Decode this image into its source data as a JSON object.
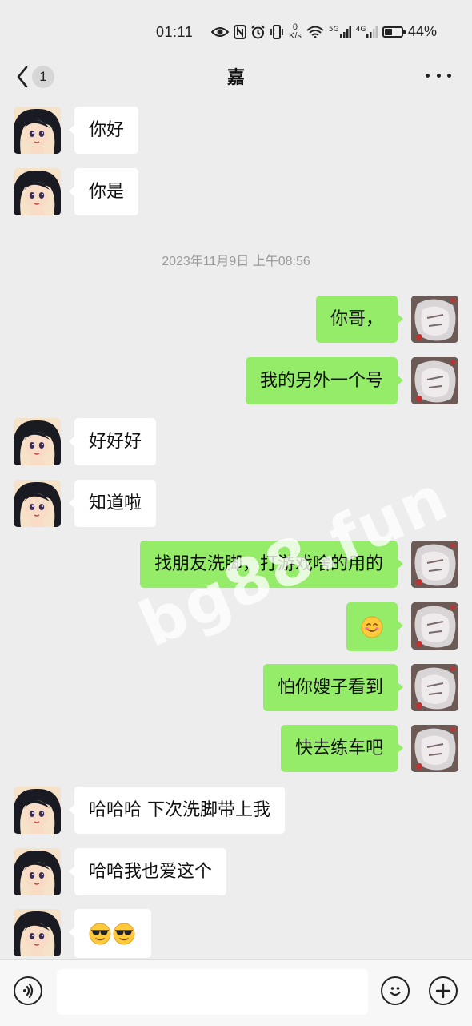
{
  "status_bar": {
    "time": "01:11",
    "net_speed_top": "0",
    "net_speed_unit": "K/s",
    "sig1": "5G",
    "sig2": "4G",
    "battery_percent": "44%",
    "battery_level": 0.44
  },
  "header": {
    "unread_count": "1",
    "title": "嘉"
  },
  "timestamp": "2023年11月9日 上午08:56",
  "messages": [
    {
      "side": "left",
      "text": "你好"
    },
    {
      "side": "left",
      "text": "你是"
    },
    {
      "side": "right",
      "text": "你哥，"
    },
    {
      "side": "right",
      "text": "我的另外一个号"
    },
    {
      "side": "left",
      "text": "好好好"
    },
    {
      "side": "left",
      "text": "知道啦"
    },
    {
      "side": "right",
      "text": "找朋友洗脚，打游戏啥的用的"
    },
    {
      "side": "right",
      "emoji": "smile-emoji"
    },
    {
      "side": "right",
      "text": "怕你嫂子看到"
    },
    {
      "side": "right",
      "text": "快去练车吧"
    },
    {
      "side": "left",
      "text": "哈哈哈 下次洗脚带上我"
    },
    {
      "side": "left",
      "text": "哈哈我也爱这个"
    },
    {
      "side": "left",
      "emoji": "sunglasses-emoji"
    }
  ],
  "watermark": "bg88.fun",
  "colors": {
    "background": "#ededed",
    "sent_bubble": "#95ec69",
    "received_bubble": "#ffffff"
  }
}
